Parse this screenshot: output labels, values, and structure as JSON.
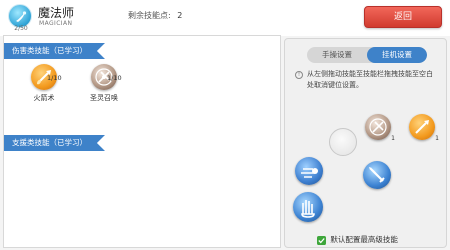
{
  "header": {
    "class_name": "魔法师",
    "class_subtitle": "MAGICIAN",
    "level": "2/50",
    "skill_points_label": "剩余技能点:",
    "skill_points_value": "2",
    "back_label": "返回"
  },
  "left_panel": {
    "attack_section_label": "伤害类技能（已学习）",
    "support_section_label": "支援类技能（已学习）",
    "attack_skills": [
      {
        "name": "火箭术",
        "count": "1/10",
        "icon": "flame-arrow-icon",
        "color": "#f39a1e"
      },
      {
        "name": "圣灵召唤",
        "count": "1/10",
        "icon": "spirit-summon-icon",
        "color": "#8a6a5a"
      }
    ]
  },
  "right_panel": {
    "tabs": [
      {
        "label": "手操设置",
        "active": false
      },
      {
        "label": "挂机设置",
        "active": true
      }
    ],
    "info_text": "从左侧拖动技能至技能栏拖拽技能至空白处取消键位设置。",
    "default_link": "默认配置最高级技能",
    "slot_counts": [
      "1",
      "1"
    ]
  },
  "colors": {
    "accent_blue": "#3e82c9",
    "back_button": "#e0473b",
    "fire_orange": "#f39a1e"
  }
}
